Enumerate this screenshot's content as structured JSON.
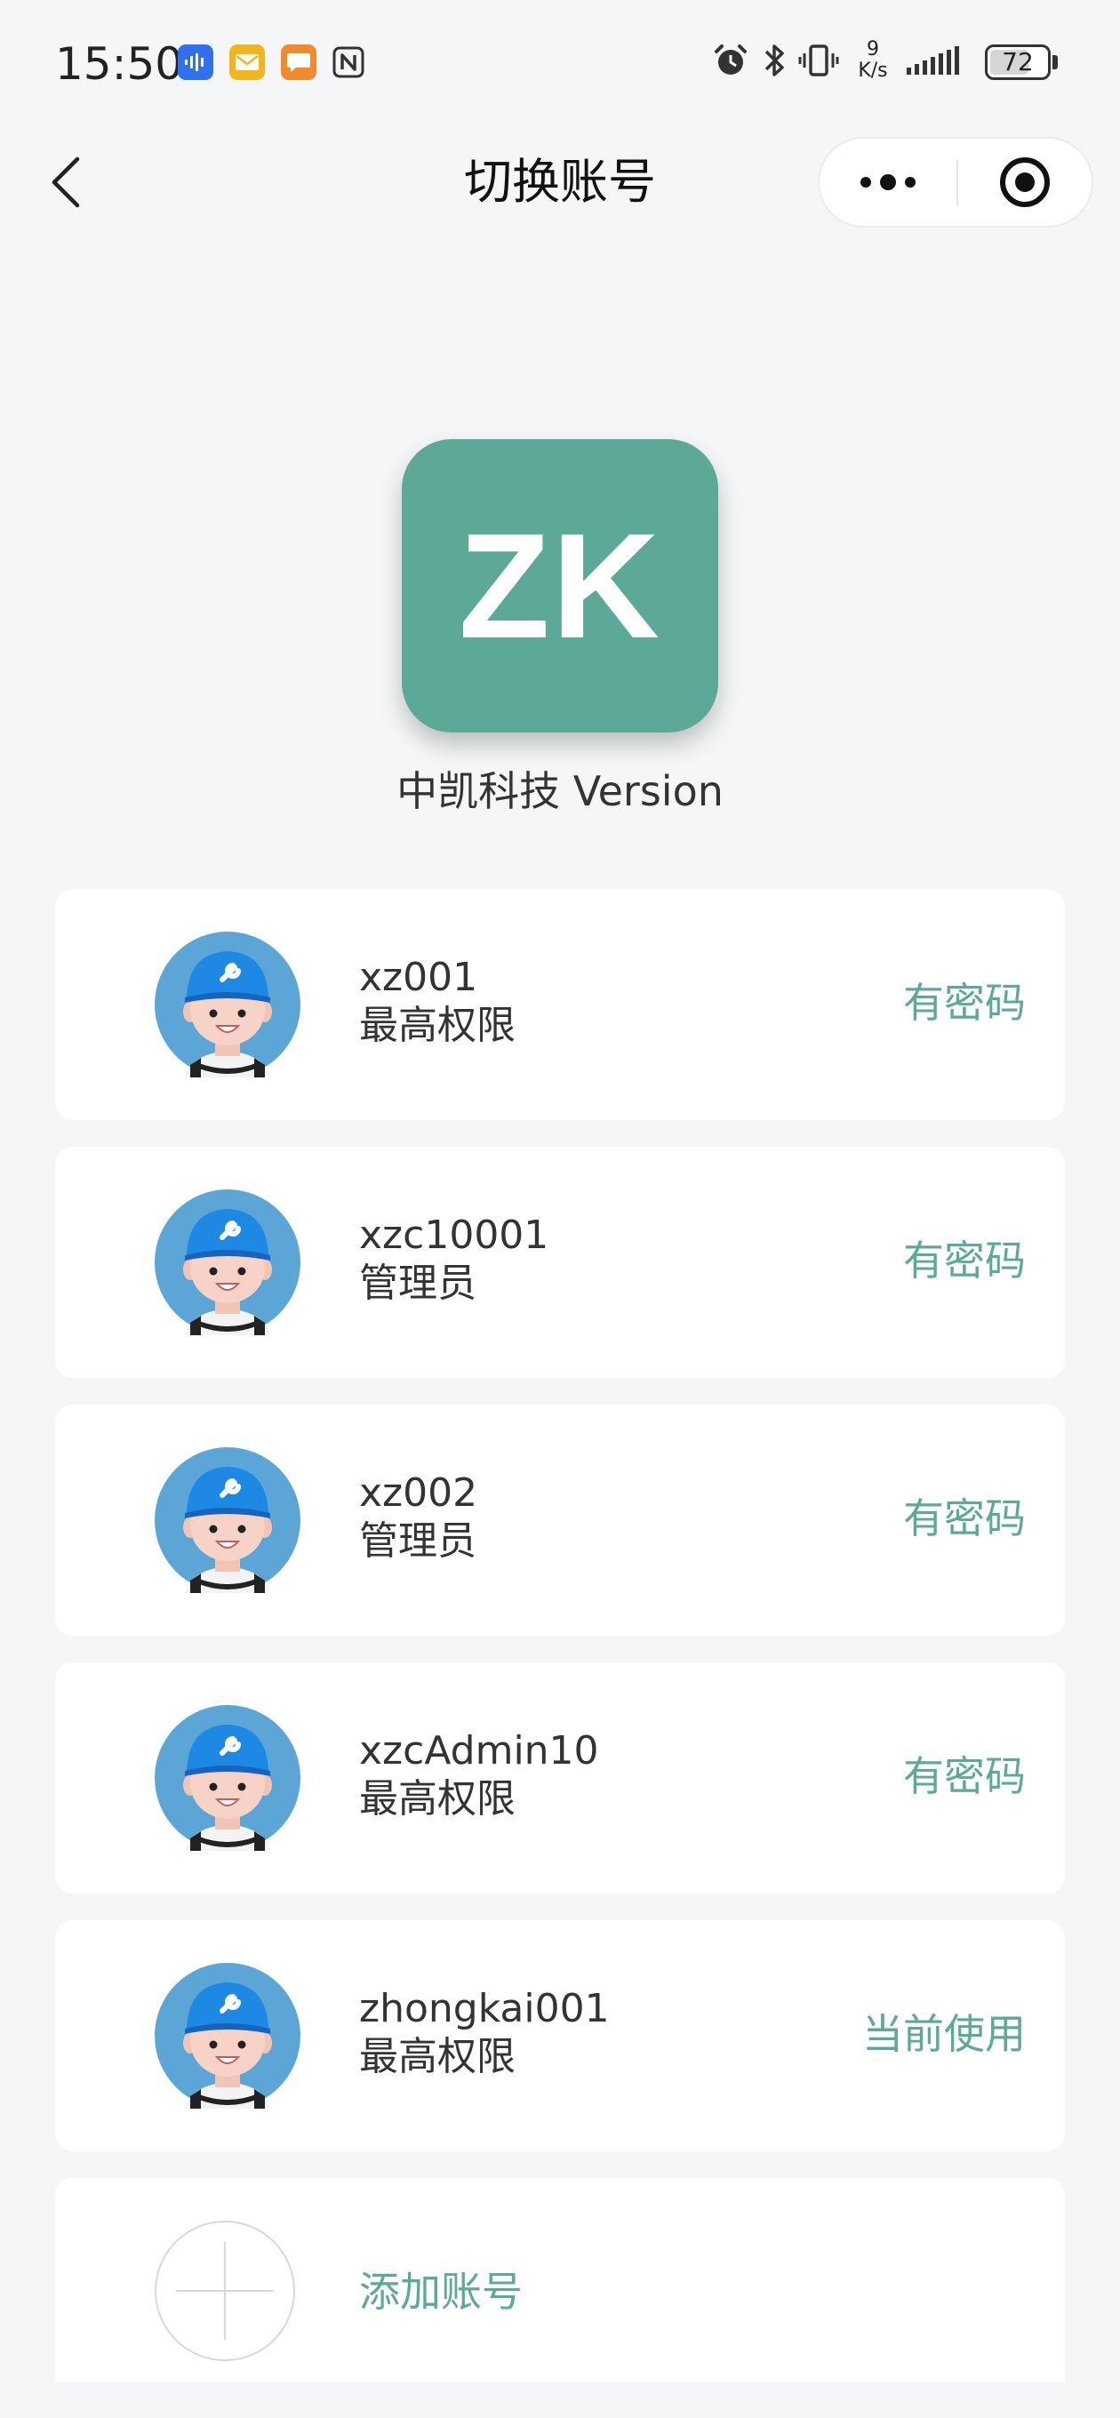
{
  "status_bar": {
    "time": "15:50",
    "net_speed_value": "9",
    "net_speed_unit": "K/s",
    "battery": "72",
    "battery_level": 0.72
  },
  "nav": {
    "title": "切换账号"
  },
  "brand": {
    "logo_text": "ZK",
    "logo_color": "#5ca997",
    "version_text": "中凯科技 Version"
  },
  "accounts": [
    {
      "name": "xz001",
      "role": "最高权限",
      "status": "有密码"
    },
    {
      "name": "xzc10001",
      "role": "管理员",
      "status": "有密码"
    },
    {
      "name": "xz002",
      "role": "管理员",
      "status": "有密码"
    },
    {
      "name": "xzcAdmin10",
      "role": "最高权限",
      "status": "有密码"
    },
    {
      "name": "zhongkai001",
      "role": "最高权限",
      "status": "当前使用"
    }
  ],
  "add_account": {
    "label": "添加账号"
  },
  "colors": {
    "accent": "#5ca997",
    "background": "#f5f6f7"
  }
}
